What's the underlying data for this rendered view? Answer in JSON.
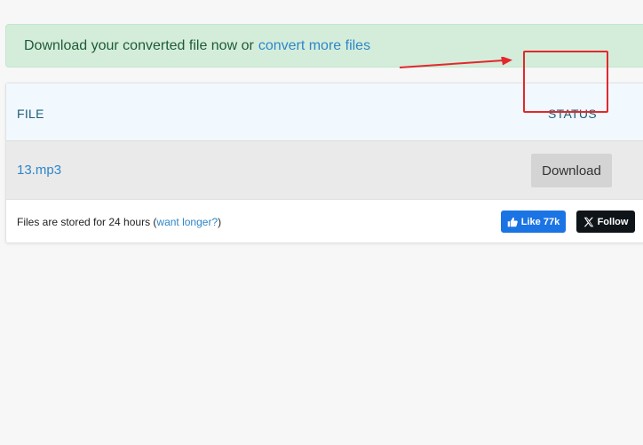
{
  "alert": {
    "message": "Download your converted file now or",
    "link_label": "convert more files"
  },
  "table": {
    "col_file": "FILE",
    "col_status": "STATUS",
    "rows": [
      {
        "file_name": "13.mp3",
        "action_label": "Download"
      }
    ]
  },
  "footer": {
    "note_prefix": "Files are stored for 24 hours (",
    "note_link": "want longer?",
    "note_suffix": ")",
    "like_label": "Like 77k",
    "follow_label": "Follow"
  },
  "colors": {
    "alert_bg": "#d4eddb",
    "link": "#2f86c9",
    "annotation": "#e3282c",
    "facebook": "#1b74e4",
    "x": "#0f1419"
  }
}
